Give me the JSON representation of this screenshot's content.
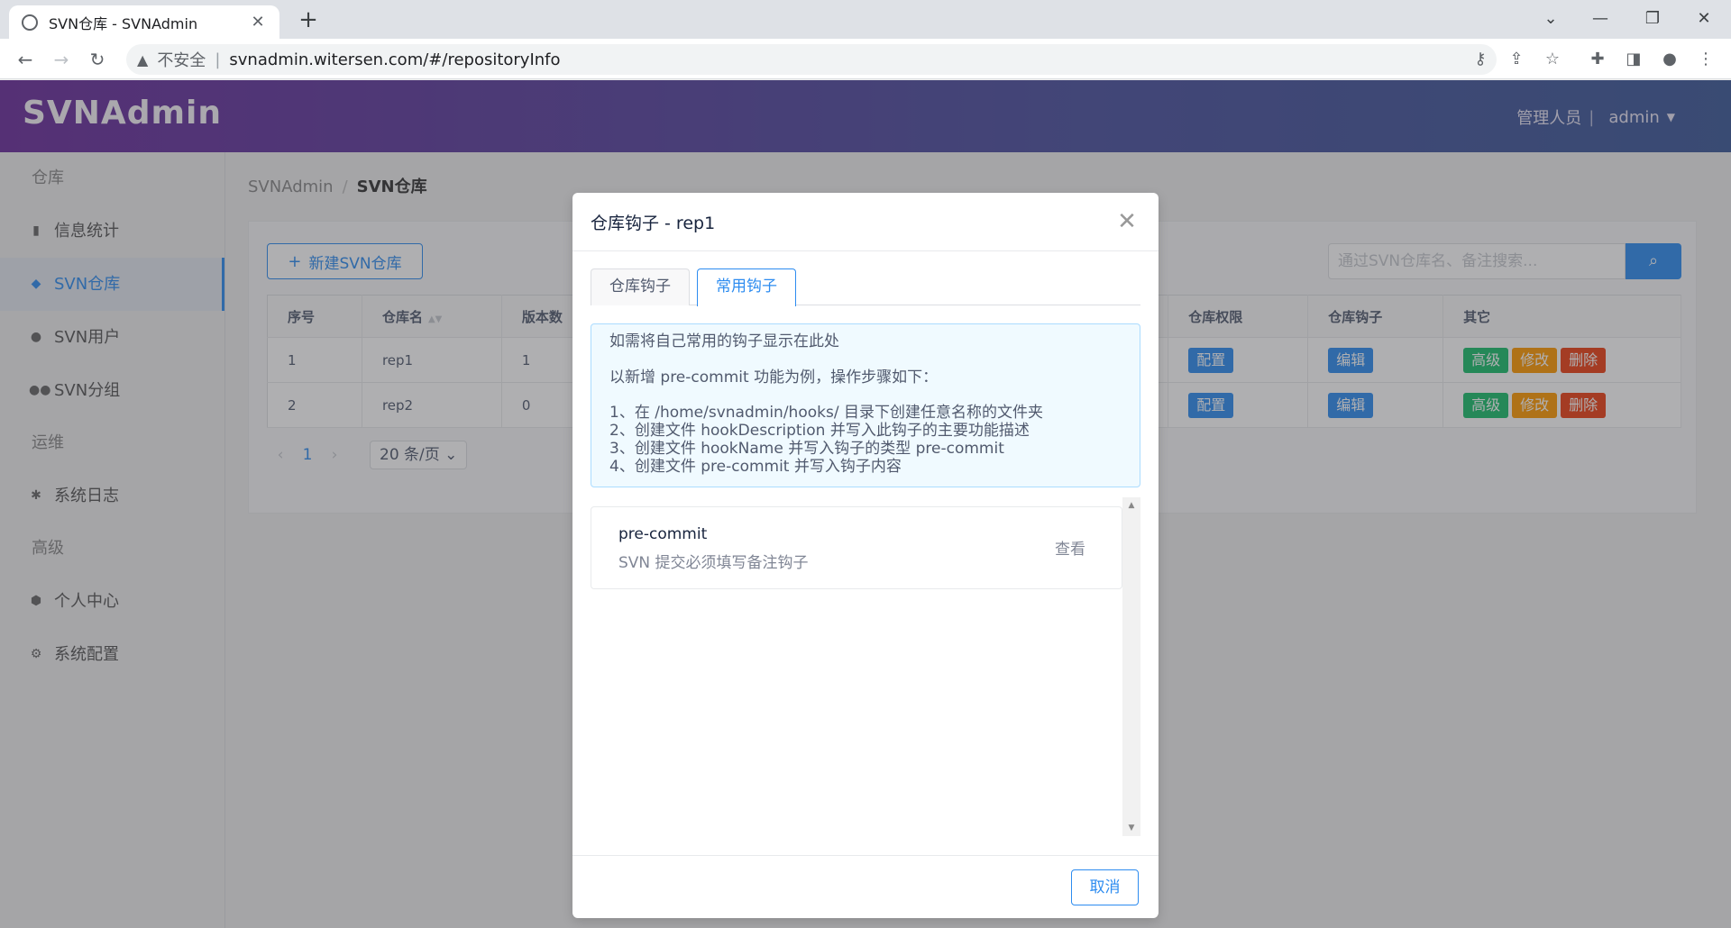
{
  "browser": {
    "tab_title": "SVN仓库 - SVNAdmin",
    "new_tab": "+",
    "insecure_label": "不安全",
    "url": "svnadmin.witersen.com/#/repositoryInfo"
  },
  "header": {
    "logo": "SVNAdmin",
    "role": "管理人员",
    "user": "admin"
  },
  "sidebar": {
    "group_repo": "仓库",
    "items_repo": [
      {
        "label": "信息统计",
        "icon": "bar-chart-icon"
      },
      {
        "label": "SVN仓库",
        "icon": "layers-icon"
      },
      {
        "label": "SVN用户",
        "icon": "person-icon"
      },
      {
        "label": "SVN分组",
        "icon": "people-icon"
      }
    ],
    "group_ops": "运维",
    "items_ops": [
      {
        "label": "系统日志",
        "icon": "bug-icon"
      }
    ],
    "group_adv": "高级",
    "items_adv": [
      {
        "label": "个人中心",
        "icon": "cube-icon"
      },
      {
        "label": "系统配置",
        "icon": "gear-icon"
      }
    ]
  },
  "main": {
    "breadcrumb": [
      "SVNAdmin",
      "SVN仓库"
    ],
    "new_button": "新建SVN仓库",
    "search_placeholder": "通过SVN仓库名、备注搜索...",
    "columns": [
      "序号",
      "仓库名",
      "版本数",
      "仓库权限",
      "仓库钩子",
      "其它"
    ],
    "rows": [
      {
        "index": "1",
        "name": "rep1",
        "revisions": "1"
      },
      {
        "index": "2",
        "name": "rep2",
        "revisions": "0"
      }
    ],
    "row_actions": {
      "config": "配置",
      "edit": "编辑",
      "advanced": "高级",
      "modify": "修改",
      "delete": "删除"
    },
    "pager": {
      "current": "1",
      "page_size": "20 条/页"
    }
  },
  "modal": {
    "title": "仓库钩子 - rep1",
    "tabs": [
      "仓库钩子",
      "常用钩子"
    ],
    "alert": {
      "title": "如需将自己常用的钩子显示在此处",
      "intro": "以新增 pre-commit 功能为例，操作步骤如下：",
      "steps": [
        "1、在 /home/svnadmin/hooks/ 目录下创建任意名称的文件夹",
        "2、创建文件 hookDescription 并写入此钩子的主要功能描述",
        "3、创建文件 hookName 并写入钩子的类型 pre-commit",
        "4、创建文件 pre-commit 并写入钩子内容"
      ]
    },
    "hooks": [
      {
        "name": "pre-commit",
        "desc": "SVN 提交必须填写备注钩子",
        "action": "查看"
      }
    ],
    "cancel": "取消"
  }
}
